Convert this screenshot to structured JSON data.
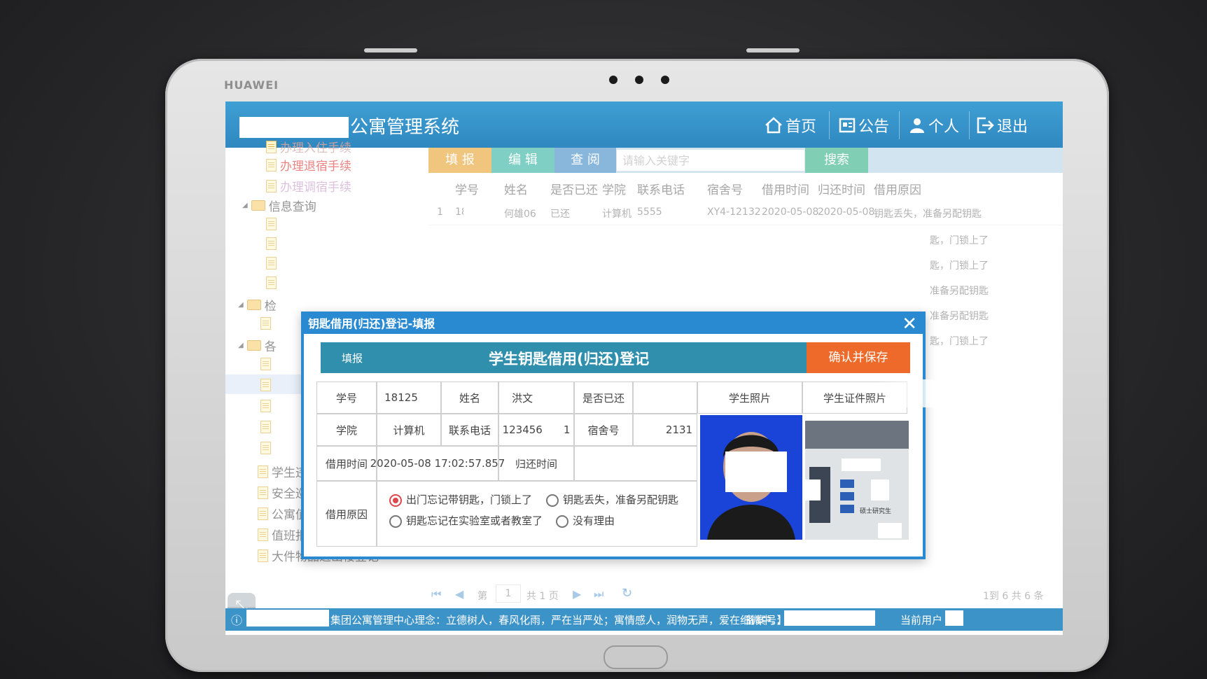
{
  "device": {
    "brand": "HUAWEI"
  },
  "header": {
    "title": "公寓管理系统",
    "nav": [
      {
        "label": "首页",
        "icon": "home-icon"
      },
      {
        "label": "公告",
        "icon": "notice-icon"
      },
      {
        "label": "个人",
        "icon": "user-icon"
      },
      {
        "label": "退出",
        "icon": "exit-icon"
      }
    ]
  },
  "sidebar": {
    "items": [
      {
        "label": "办理入住手续"
      },
      {
        "label": "办理退宿手续"
      },
      {
        "label": "办理调宿手续"
      },
      {
        "label": "信息查询"
      },
      {
        "label": "检"
      },
      {
        "label": "各"
      },
      {
        "label": "学生违纪记录登记"
      },
      {
        "label": "安全巡视记录登记"
      },
      {
        "label": "公寓值班记录登记"
      },
      {
        "label": "值班报修记录登记"
      },
      {
        "label": "大件物品进出楼登记"
      }
    ]
  },
  "toolbar": {
    "fill": "填 报",
    "edit": "编 辑",
    "view": "查 阅",
    "search_placeholder": "请输入关键字",
    "search_button": "搜索"
  },
  "grid": {
    "columns": [
      "学号",
      "姓名",
      "是否已还",
      "学院",
      "联系电话",
      "宿舍号",
      "借用时间",
      "归还时间",
      "借用原因"
    ],
    "rows": [
      {
        "index": "1",
        "student_id": "18",
        "name": "何雄06",
        "returned": "已还",
        "college": "计算机",
        "phone": "5555",
        "dorm": "XY4-12132",
        "borrow_time": "2020-05-08",
        "return_time": "2020-05-08",
        "reason": "钥匙丢失，准备另配钥匙"
      }
    ],
    "right_reasons": [
      "匙，门锁上了",
      "匙，门锁上了",
      "准备另配钥匙",
      "准备另配钥匙",
      "匙，门锁上了"
    ]
  },
  "pager": {
    "page_prefix": "第",
    "page_value": "1",
    "page_total": "共 1 页",
    "summary": "1到 6 共 6 条"
  },
  "footer": {
    "motto": "集团公寓管理中心理念：立德树人，春风化雨，严在当严处；寓情感人，润物无声，爱在细微中。】",
    "record_label": "备案号:",
    "user_label": "当前用户"
  },
  "dialog": {
    "title": "钥匙借用(归还)登记-填报",
    "strip_label": "填报",
    "heading": "学生钥匙借用(归还)登记",
    "save": "确认并保存",
    "fields": {
      "student_id_label": "学号",
      "student_id": "18125",
      "name_label": "姓名",
      "name": "洪文",
      "returned_label": "是否已还",
      "returned": "",
      "college_label": "学院",
      "college": "计算机",
      "phone_label": "联系电话",
      "phone": "123456",
      "phone_tail": "1",
      "dorm_label": "宿舍号",
      "dorm": "2131",
      "borrow_time_label": "借用时间",
      "borrow_time": "2020-05-08 17:02:57.857",
      "return_time_label": "归还时间",
      "return_time": "",
      "reason_label": "借用原因",
      "photo_label": "学生照片",
      "id_photo_label": "学生证件照片"
    },
    "reasons": [
      {
        "label": "出门忘记带钥匙，门锁上了",
        "checked": true
      },
      {
        "label": "钥匙丢失，准备另配钥匙",
        "checked": false
      },
      {
        "label": "钥匙忘记在实验室或者教室了",
        "checked": false
      },
      {
        "label": "没有理由",
        "checked": false
      }
    ],
    "id_card_text": "硕士研究生"
  },
  "colors": {
    "header": "#2f88c0",
    "dialog_border": "#2a8ad1",
    "save_button": "#ee6a2a",
    "tab_fill": "#e8a73a",
    "tab_edit": "#3bb6a6",
    "tab_view": "#4a8fc8",
    "search_button": "#3db58d"
  }
}
